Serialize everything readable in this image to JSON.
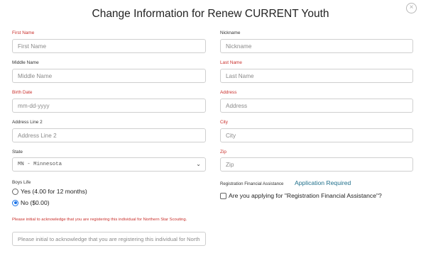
{
  "dialog": {
    "title": "Change Information for Renew CURRENT Youth",
    "close_symbol": "×"
  },
  "fields": {
    "first_name": {
      "label": "First Name",
      "placeholder": "First Name"
    },
    "nickname": {
      "label": "Nickname",
      "placeholder": "Nickname"
    },
    "middle_name": {
      "label": "Middle Name",
      "placeholder": "Middle Name"
    },
    "last_name": {
      "label": "Last Name",
      "placeholder": "Last Name"
    },
    "birth_date": {
      "label": "Birth Date",
      "placeholder": "mm-dd-yyyy"
    },
    "address": {
      "label": "Address",
      "placeholder": "Address"
    },
    "address_line_2": {
      "label": "Address Line 2",
      "placeholder": "Address Line 2"
    },
    "city": {
      "label": "City",
      "placeholder": "City"
    },
    "state": {
      "label": "State",
      "value": "MN - Minnesota"
    },
    "zip": {
      "label": "Zip",
      "placeholder": "Zip"
    }
  },
  "boys_life": {
    "label": "Boys Life",
    "options": [
      {
        "label": "Yes (4.00 for 12 months)",
        "selected": false
      },
      {
        "label": "No ($0.00)",
        "selected": true
      }
    ]
  },
  "financial_assistance": {
    "label": "Registration Financial Assistance",
    "link": "Application Required",
    "checkbox_label": "Are you applying for \"Registration Financial Assistance\"?"
  },
  "acknowledgement": {
    "notice": "Please initial to acknowledge that you are registering this individual for Northern Star Scouting.",
    "placeholder": "Please initial to acknowledge that you are registering this individual for Northern Star Scouting."
  },
  "colors": {
    "required_label": "#c9302c",
    "link": "#1f6f8b",
    "radio_selected": "#1a73e8"
  }
}
